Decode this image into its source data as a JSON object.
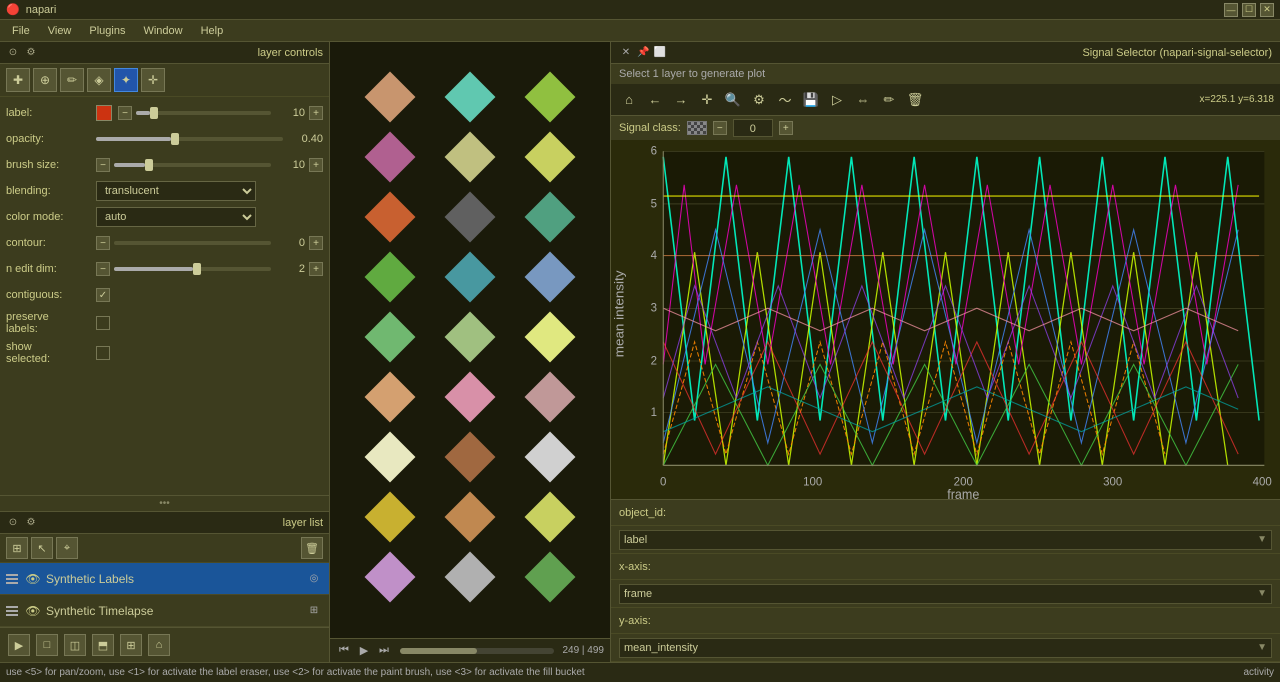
{
  "app": {
    "title": "napari",
    "window_controls": [
      "—",
      "☐",
      "✕"
    ]
  },
  "menubar": {
    "items": [
      "File",
      "View",
      "Plugins",
      "Window",
      "Help"
    ]
  },
  "layer_controls": {
    "header": "layer controls",
    "tools": [
      "transform",
      "paint",
      "eyedropper",
      "fill",
      "point",
      "move"
    ],
    "label_value": "10",
    "opacity_value": "0.40",
    "brush_size_value": "10",
    "blending_value": "translucent",
    "color_mode_value": "auto",
    "contour_value": "0",
    "n_edit_dim_value": "2",
    "contiguous": true,
    "preserve_labels": false,
    "show_selected": false
  },
  "layer_list": {
    "header": "layer list",
    "layers": [
      {
        "name": "Synthetic Labels",
        "visible": true,
        "type": "labels",
        "active": true
      },
      {
        "name": "Synthetic Timelapse",
        "visible": true,
        "type": "image",
        "active": false
      }
    ]
  },
  "canvas": {
    "shapes": [
      {
        "col": 0,
        "row": 0,
        "color": "#c8956e"
      },
      {
        "col": 0,
        "row": 1,
        "color": "#b06090"
      },
      {
        "col": 0,
        "row": 2,
        "color": "#c86030"
      },
      {
        "col": 0,
        "row": 3,
        "color": "#60aa40"
      },
      {
        "col": 0,
        "row": 4,
        "color": "#70b870"
      },
      {
        "col": 0,
        "row": 5,
        "color": "#d4a070"
      },
      {
        "col": 0,
        "row": 6,
        "color": "#e8e8c0"
      },
      {
        "col": 0,
        "row": 7,
        "color": "#c8b030"
      },
      {
        "col": 0,
        "row": 8,
        "color": "#c090c8"
      },
      {
        "col": 1,
        "row": 0,
        "color": "#60c8b0"
      },
      {
        "col": 1,
        "row": 1,
        "color": "#c0c080"
      },
      {
        "col": 1,
        "row": 2,
        "color": "#606060"
      },
      {
        "col": 1,
        "row": 3,
        "color": "#4898a0"
      },
      {
        "col": 1,
        "row": 4,
        "color": "#a0c080"
      },
      {
        "col": 1,
        "row": 5,
        "color": "#d890a8"
      },
      {
        "col": 1,
        "row": 6,
        "color": "#a06840"
      },
      {
        "col": 1,
        "row": 7,
        "color": "#c08850"
      },
      {
        "col": 1,
        "row": 8,
        "color": "#b0b0b0"
      },
      {
        "col": 2,
        "row": 0,
        "color": "#90c040"
      },
      {
        "col": 2,
        "row": 1,
        "color": "#c8d060"
      },
      {
        "col": 2,
        "row": 2,
        "color": "#50a080"
      },
      {
        "col": 2,
        "row": 3,
        "color": "#7898c0"
      },
      {
        "col": 2,
        "row": 4,
        "color": "#e0e880"
      },
      {
        "col": 2,
        "row": 5,
        "color": "#c09898"
      },
      {
        "col": 2,
        "row": 6,
        "color": "#d0d0d0"
      },
      {
        "col": 2,
        "row": 7,
        "color": "#c8d060"
      },
      {
        "col": 2,
        "row": 8,
        "color": "#60a050"
      }
    ]
  },
  "playback": {
    "current_frame": "249",
    "total_frames": "499",
    "frame_label": "249 | 499"
  },
  "signal_selector": {
    "title": "Signal Selector (napari-signal-selector)",
    "select_msg": "Select 1 layer to generate plot",
    "coords": "x=225.1 y=6.318",
    "signal_class_label": "Signal class:",
    "signal_class_value": "0",
    "toolbar_buttons": [
      "home",
      "back",
      "forward",
      "pan",
      "zoom",
      "settings",
      "curve",
      "save",
      "select",
      "range",
      "draw",
      "delete"
    ],
    "x_axis_label": "x-axis:",
    "x_axis_value": "frame",
    "y_axis_label": "y-axis:",
    "y_axis_value": "mean_intensity",
    "object_id_label": "object_id:",
    "object_id_value": "label",
    "chart": {
      "x_label": "frame",
      "y_label": "mean intensity",
      "x_ticks": [
        "0",
        "100",
        "200",
        "300",
        "400"
      ],
      "y_ticks": [
        "1",
        "2",
        "3",
        "4",
        "5",
        "6"
      ]
    }
  },
  "status_bar": {
    "text": "use <5> for pan/zoom, use <1> for activate the label eraser, use <2> for activate the paint brush, use <3> for activate the fill bucket",
    "activity": "activity"
  }
}
